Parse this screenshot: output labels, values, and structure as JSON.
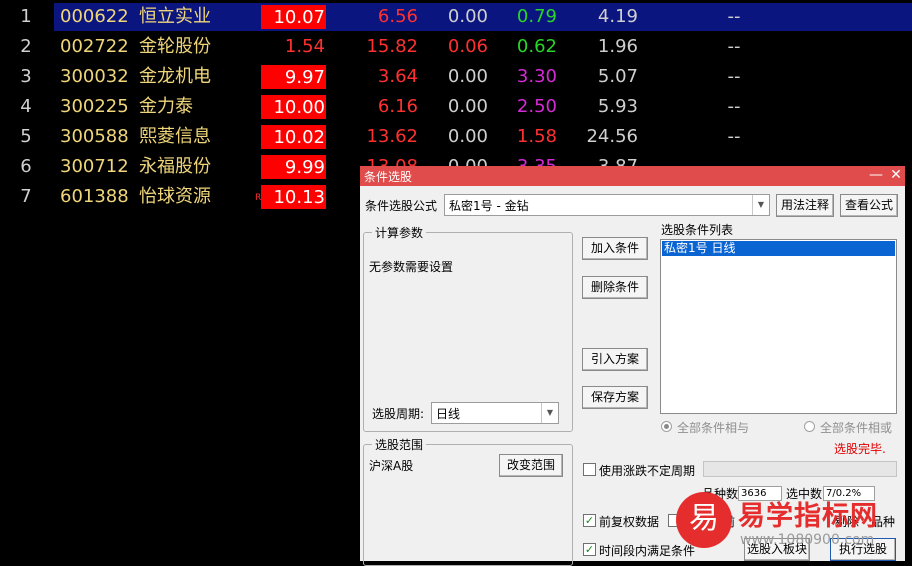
{
  "stock_list": [
    {
      "no": "1",
      "code": "000622",
      "name": "恒立实业",
      "pct": "10.07",
      "c1": "6.56",
      "c2": "0.00",
      "c3": "0.79",
      "c4": "4.19",
      "c5": "--"
    },
    {
      "no": "2",
      "code": "002722",
      "name": "金轮股份",
      "pct": "1.54",
      "c1": "15.82",
      "c2": "0.06",
      "c3": "0.62",
      "c4": "1.96",
      "c5": "--"
    },
    {
      "no": "3",
      "code": "300032",
      "name": "金龙机电",
      "pct": "9.97",
      "c1": "3.64",
      "c2": "0.00",
      "c3": "3.30",
      "c4": "5.07",
      "c5": "--"
    },
    {
      "no": "4",
      "code": "300225",
      "name": "金力泰",
      "pct": "10.00",
      "c1": "6.16",
      "c2": "0.00",
      "c3": "2.50",
      "c4": "5.93",
      "c5": "--"
    },
    {
      "no": "5",
      "code": "300588",
      "name": "熙菱信息",
      "pct": "10.02",
      "c1": "13.62",
      "c2": "0.00",
      "c3": "1.58",
      "c4": "24.56",
      "c5": "--"
    },
    {
      "no": "6",
      "code": "300712",
      "name": "永福股份",
      "pct": "9.99",
      "c1": "13.08",
      "c2": "0.00",
      "c3": "3.35",
      "c4": "3.87",
      "c5": "--"
    },
    {
      "no": "7",
      "code": "601388",
      "name": "怡球资源",
      "pct": "10.13",
      "r_mark": "R"
    }
  ],
  "dialog": {
    "title": "条件选股",
    "minimize": "—",
    "close": "✕",
    "formula_label": "条件选股公式",
    "formula_value": "私密1号        - 金钻",
    "usage_button": "用法注释",
    "view_formula_button": "查看公式",
    "params_group": "计算参数",
    "params_text": "无参数需要设置",
    "period_label": "选股周期:",
    "period_value": "日线",
    "add_condition": "加入条件",
    "delete_condition": "删除条件",
    "import_plan": "引入方案",
    "save_plan": "保存方案",
    "condition_list_label": "选股条件列表",
    "condition_items": [
      "私密1号   日线"
    ],
    "radio_and": "全部条件相与",
    "radio_or": "全部条件相或",
    "status": "选股完毕.",
    "scope_group": "选股范围",
    "scope_value": "沪深A股",
    "change_scope": "改变范围",
    "use_uncertain_period": "使用涨跌不定周期",
    "count_label": "品种数",
    "count_value": "3636",
    "selected_label": "选中数",
    "selected_value": "7/0.2%",
    "pre_adjust": "前复权数据",
    "exclude_text": "前",
    "exclude_text2": "剔除",
    "exclude_suffix": "品种",
    "time_condition": "时间段内满足条件",
    "to_block": "选股入板块",
    "execute": "执行选股"
  },
  "watermark": {
    "glyph": "易",
    "name": "易学指标网",
    "url": "www.1080900.com"
  },
  "colors": {
    "up_bg": "#ff0000",
    "selection": "#0b1580",
    "title_bar": "#e04b4b"
  }
}
